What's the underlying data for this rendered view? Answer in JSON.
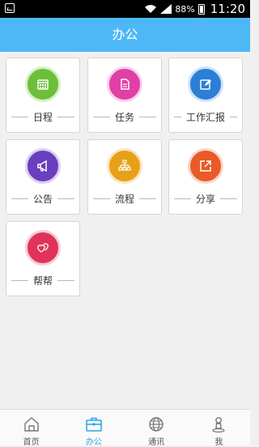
{
  "status_bar": {
    "battery": "88%",
    "time": "11:20"
  },
  "header": {
    "title": "办公"
  },
  "modules": [
    {
      "label": "日程",
      "icon": "calendar-icon",
      "color": "#6dbf3a",
      "ring": "#d8efc8"
    },
    {
      "label": "任务",
      "icon": "document-icon",
      "color": "#e03fa6",
      "ring": "#f8cfe8"
    },
    {
      "label": "工作汇报",
      "icon": "edit-icon",
      "color": "#2b7fd6",
      "ring": "#cfe2f7"
    },
    {
      "label": "公告",
      "icon": "megaphone-icon",
      "color": "#6a3fbd",
      "ring": "#dcd0f2"
    },
    {
      "label": "流程",
      "icon": "flowchart-icon",
      "color": "#e8a019",
      "ring": "#f8e6c2"
    },
    {
      "label": "分享",
      "icon": "share-icon",
      "color": "#ea5a27",
      "ring": "#f9d6c9"
    },
    {
      "label": "帮帮",
      "icon": "hearts-icon",
      "color": "#e0335a",
      "ring": "#f6cdd6"
    }
  ],
  "tabs": [
    {
      "label": "首页",
      "icon": "home-icon",
      "active": false
    },
    {
      "label": "办公",
      "icon": "briefcase-icon",
      "active": true
    },
    {
      "label": "通讯",
      "icon": "globe-icon",
      "active": false
    },
    {
      "label": "我",
      "icon": "person-icon",
      "active": false
    }
  ],
  "colors": {
    "accent": "#4db8f5",
    "tab_active": "#2aa2e8"
  }
}
